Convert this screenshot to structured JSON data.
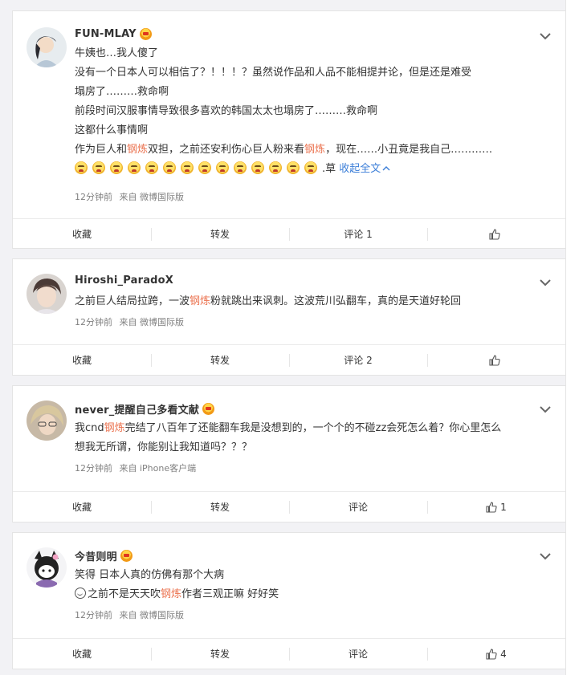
{
  "comments": [
    {
      "username": "FUN-MLAY",
      "lines": [
        [
          {
            "t": "牛姨也…我人傻了"
          }
        ],
        [
          {
            "t": "没有一个日本人可以相信了？！！！？虽然说作品和人品不能相提并论，但是还是难受"
          }
        ],
        [
          {
            "t": "塌房了………救命啊"
          }
        ],
        [
          {
            "t": "前段时间汉服事情导致很多喜欢的韩国太太也塌房了………救命啊"
          }
        ],
        [
          {
            "t": "这都什么事情啊"
          }
        ],
        [
          {
            "t": "作为巨人和"
          },
          {
            "t": "钢炼",
            "hl": true
          },
          {
            "t": "双担，之前还安利伤心巨人粉来看"
          },
          {
            "t": "钢炼",
            "hl": true
          },
          {
            "t": "，现在……小丑竟是我自己…………"
          }
        ]
      ],
      "emoji_count": 14,
      "emoji_tail": ".草",
      "collapse_label": "收起全文",
      "time": "12分钟前",
      "source": "来自 微博国际版",
      "actions": {
        "fav": "收藏",
        "repost": "转发",
        "comment": "评论 1",
        "like": ""
      }
    },
    {
      "username": "Hiroshi_ParadoX",
      "lines": [
        [
          {
            "t": "之前巨人结局拉跨，一波"
          },
          {
            "t": "钢炼",
            "hl": true
          },
          {
            "t": "粉就跳出来讽刺。这波荒川弘翻车，真的是天道好轮回"
          }
        ]
      ],
      "time": "12分钟前",
      "source": "来自 微博国际版",
      "actions": {
        "fav": "收藏",
        "repost": "转发",
        "comment": "评论 2",
        "like": ""
      }
    },
    {
      "username": "never_提醒自己多看文献",
      "lines": [
        [
          {
            "t": "我cnd"
          },
          {
            "t": "钢炼",
            "hl": true
          },
          {
            "t": "完结了八百年了还能翻车我是没想到的，一个个的不碰zz会死怎么着？你心里怎么"
          }
        ],
        [
          {
            "t": "想我无所谓，你能别让我知道吗？？？"
          }
        ]
      ],
      "time": "12分钟前",
      "source": "来自 iPhone客户端",
      "actions": {
        "fav": "收藏",
        "repost": "转发",
        "comment": "评论",
        "like": "1"
      }
    },
    {
      "username": "今昔则明",
      "lines": [
        [
          {
            "t": "笑得 日本人真的仿佛有那个大病"
          }
        ],
        [
          {
            "smile": true
          },
          {
            "t": "之前不是天天吹"
          },
          {
            "t": "钢炼",
            "hl": true
          },
          {
            "t": "作者三观正嘛 好好笑"
          }
        ]
      ],
      "time": "12分钟前",
      "source": "来自 微博国际版",
      "actions": {
        "fav": "收藏",
        "repost": "转发",
        "comment": "评论",
        "like": "4"
      }
    }
  ],
  "colors": {
    "highlight": "#eb7350",
    "link": "#3b7ed8",
    "meta": "#808080"
  }
}
